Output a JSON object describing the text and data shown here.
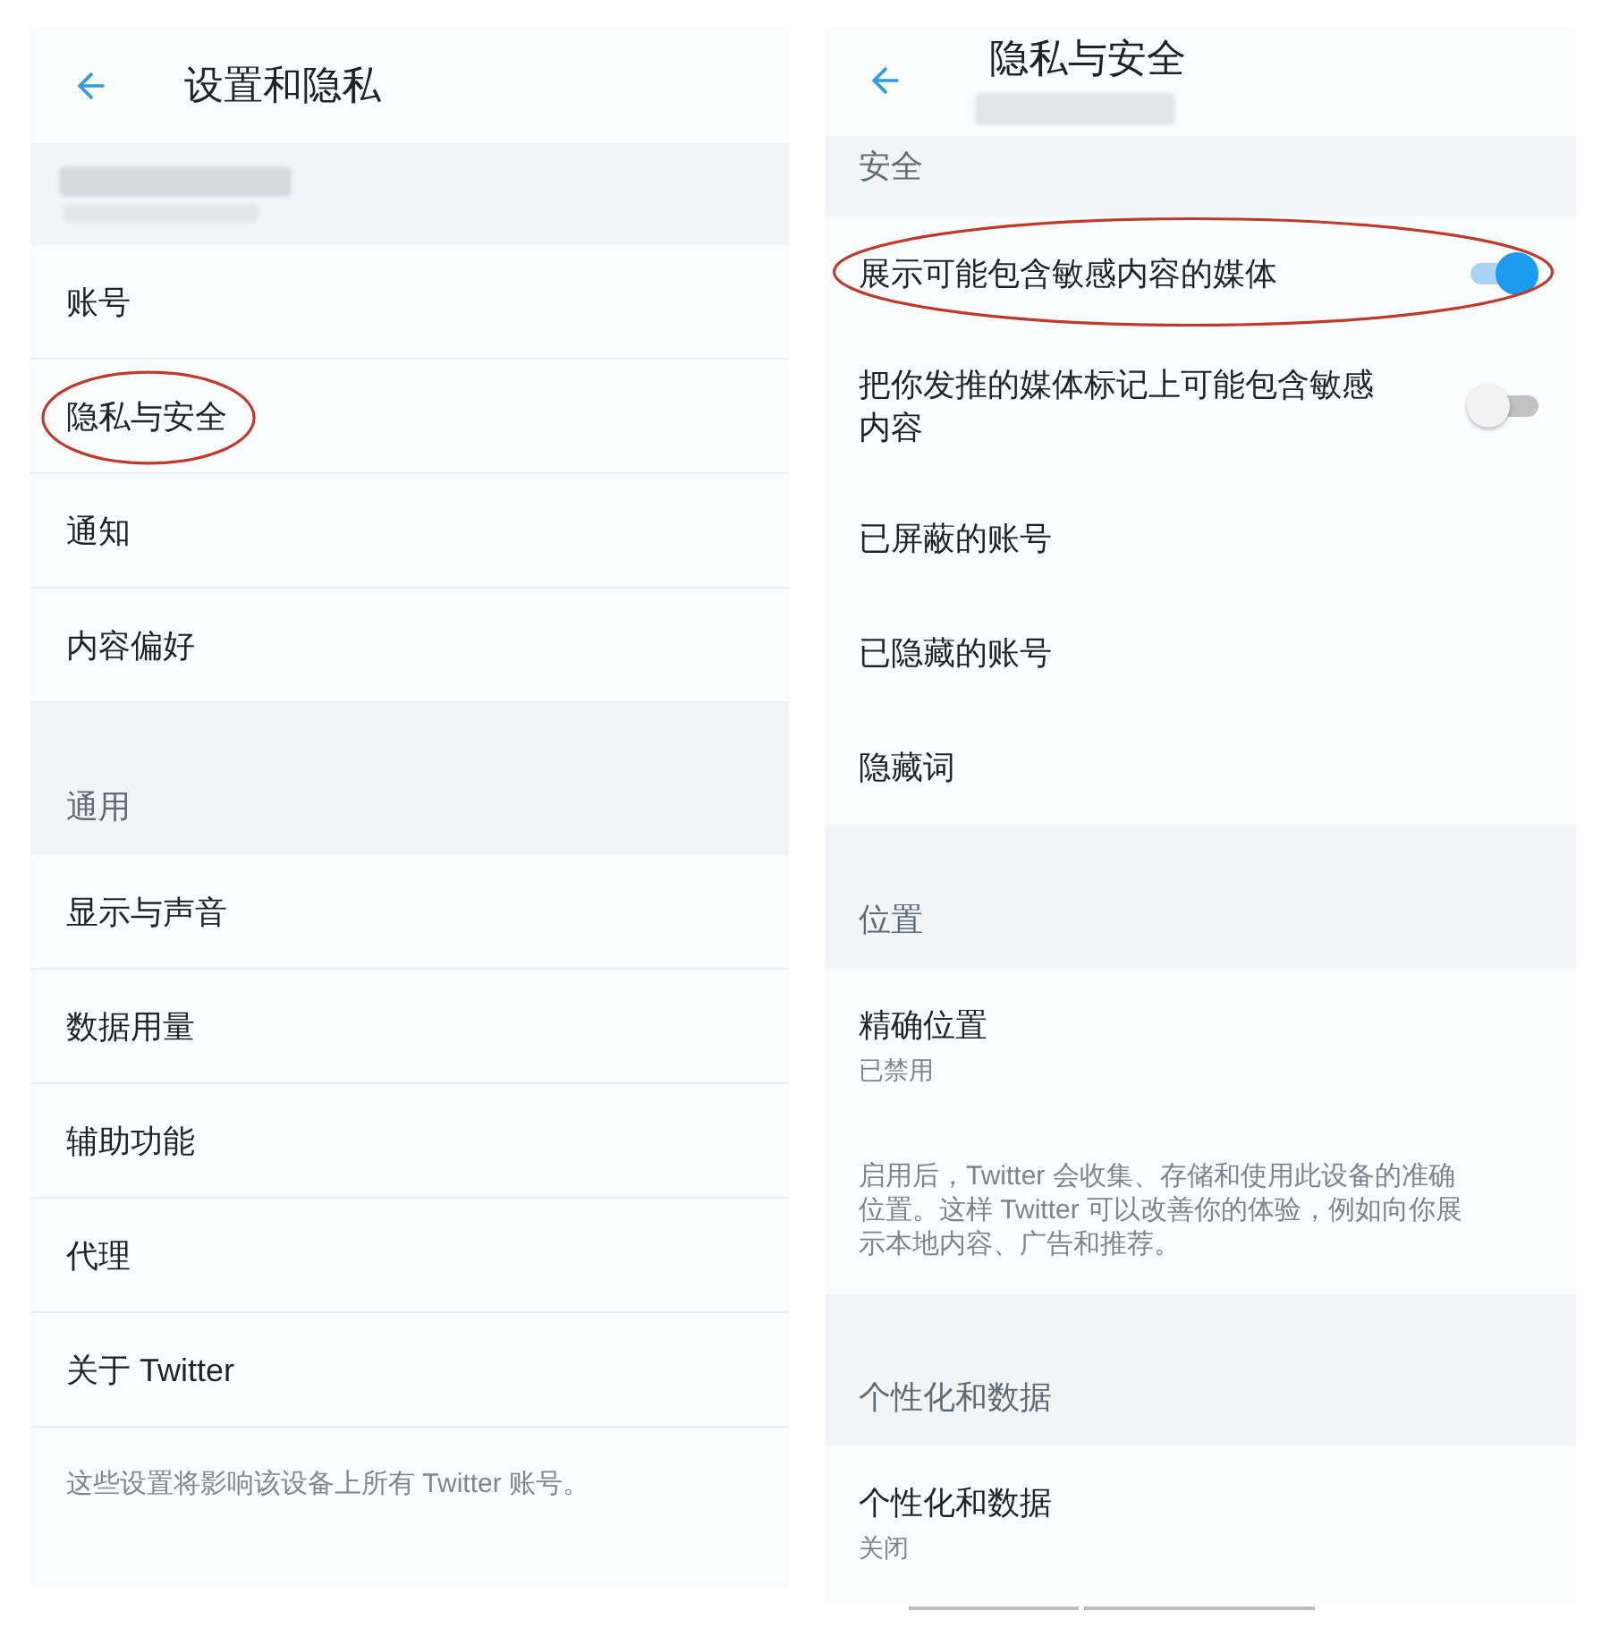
{
  "left_screen": {
    "title": "设置和隐私",
    "sections": [
      {
        "items": [
          {
            "label": "账号",
            "circled": false
          },
          {
            "label": "隐私与安全",
            "circled": true
          },
          {
            "label": "通知",
            "circled": false
          },
          {
            "label": "内容偏好",
            "circled": false
          }
        ]
      },
      {
        "heading": "通用",
        "items": [
          {
            "label": "显示与声音",
            "circled": false
          },
          {
            "label": "数据用量",
            "circled": false
          },
          {
            "label": "辅助功能",
            "circled": false
          },
          {
            "label": "代理",
            "circled": false
          },
          {
            "label": "关于 Twitter",
            "circled": false
          }
        ]
      }
    ],
    "footnote": "这些设置将影响该设备上所有 Twitter 账号。"
  },
  "right_screen": {
    "title": "隐私与安全",
    "sections": [
      {
        "heading": "安全",
        "items": [
          {
            "kind": "toggle",
            "label": "展示可能包含敏感内容的媒体",
            "on": true,
            "circled": true
          },
          {
            "kind": "toggle",
            "label": "把你发推的媒体标记上可能包含敏感内容",
            "on": false,
            "circled": false
          },
          {
            "kind": "link",
            "label": "已屏蔽的账号",
            "circled": false
          },
          {
            "kind": "link",
            "label": "已隐藏的账号",
            "circled": false
          },
          {
            "kind": "link",
            "label": "隐藏词",
            "circled": false
          }
        ]
      },
      {
        "heading": "位置",
        "items": [
          {
            "kind": "detail",
            "label": "精确位置",
            "value": "已禁用",
            "circled": false
          },
          {
            "kind": "note",
            "label": "启用后，Twitter 会收集、存储和使用此设备的准确位置。这样 Twitter 可以改善你的体验，例如向你展示本地内容、广告和推荐。",
            "circled": false
          }
        ]
      },
      {
        "heading": "个性化和数据",
        "items": [
          {
            "kind": "detail",
            "label": "个性化和数据",
            "value": "关闭",
            "circled": false
          }
        ]
      }
    ]
  }
}
